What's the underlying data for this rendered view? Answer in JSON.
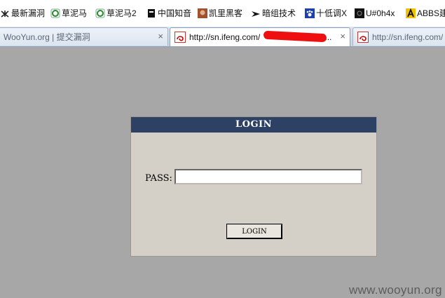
{
  "bookmarks": [
    {
      "label": "最新漏洞",
      "icon": "bug-icon"
    },
    {
      "label": "草泥马",
      "icon": "green-globe-icon"
    },
    {
      "label": "草泥马2",
      "icon": "green-globe-icon"
    },
    {
      "label": "中国知音",
      "icon": "black-page-icon"
    },
    {
      "label": "凯里黑客",
      "icon": "avatar-icon"
    },
    {
      "label": "暗组技术",
      "icon": "black-bird-icon"
    },
    {
      "label": "十低调X",
      "icon": "paw-icon"
    },
    {
      "label": "U#0h4x",
      "icon": "black-square-icon"
    },
    {
      "label": "ABBS建",
      "icon": "yellow-a-icon"
    }
  ],
  "tabs": [
    {
      "title": "WooYun.org | 提交漏洞",
      "close": "×"
    },
    {
      "title": "http://sn.ifeng.com/",
      "close": "×",
      "title_tail": "..."
    },
    {
      "title": "http://sn.ifeng.com/"
    }
  ],
  "login": {
    "header": "LOGIN",
    "pass_label": "PASS:",
    "pass_value": "",
    "button_label": "LOGIN"
  },
  "watermark": "www.wooyun.org",
  "colors": {
    "background": "#a7a7a7",
    "dialog_header": "#2c4164",
    "dialog_body": "#d4d0c8",
    "redaction": "#ee1010"
  }
}
